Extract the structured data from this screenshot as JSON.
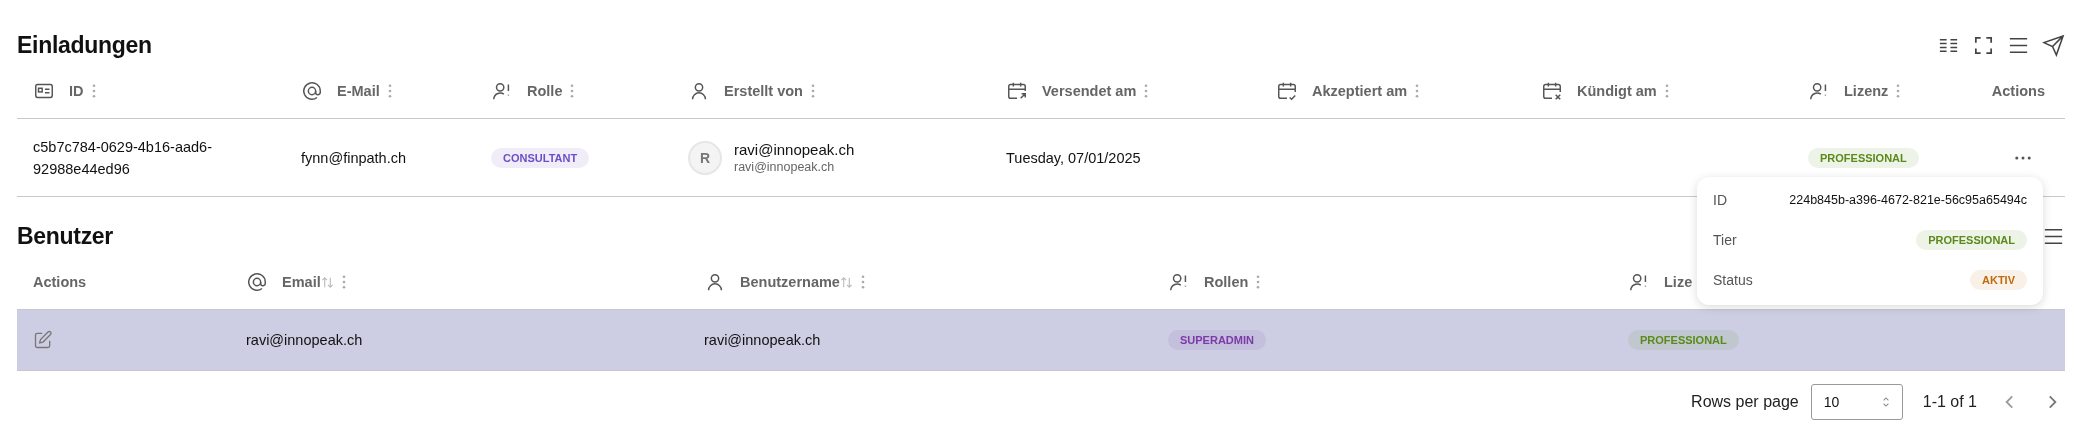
{
  "invitations": {
    "title": "Einladungen",
    "columns": [
      {
        "kind": "id",
        "label": "ID",
        "menu": true
      },
      {
        "kind": "email",
        "label": "E-Mail",
        "menu": true
      },
      {
        "kind": "role",
        "label": "Rolle",
        "menu": true
      },
      {
        "kind": "person",
        "label": "Erstellt von",
        "menu": true
      },
      {
        "kind": "sent",
        "label": "Versendet am",
        "menu": true
      },
      {
        "kind": "accepted",
        "label": "Akzeptiert am",
        "menu": true
      },
      {
        "kind": "terminated",
        "label": "Kündigt am",
        "menu": true
      },
      {
        "kind": "license",
        "label": "Lizenz",
        "menu": true
      },
      {
        "kind": "actions",
        "label": "Actions"
      }
    ],
    "rows": [
      {
        "selected": false,
        "cells": [
          {
            "kind": "text",
            "text": "c5b7c784-0629-4b16-aad6-92988e44ed96"
          },
          {
            "kind": "text",
            "text": "fynn@finpath.ch"
          },
          {
            "kind": "badge",
            "text": "CONSULTANT",
            "color": "#6a4fc8"
          },
          {
            "kind": "user",
            "avatar": "R",
            "name": "ravi@innopeak.ch",
            "email": "ravi@innopeak.ch"
          },
          {
            "kind": "text",
            "text": "Tuesday, 07/01/2025"
          },
          {
            "kind": "empty"
          },
          {
            "kind": "empty"
          },
          {
            "kind": "badge",
            "text": "PROFESSIONAL",
            "color": "#5a8a1a"
          },
          {
            "kind": "more"
          }
        ]
      }
    ]
  },
  "users": {
    "title": "Benutzer",
    "columns": [
      {
        "kind": "actions",
        "label": "Actions"
      },
      {
        "kind": "email",
        "label": "Email",
        "menu": true,
        "sortable": true
      },
      {
        "kind": "person",
        "label": "Benutzername",
        "menu": true,
        "sortable": true
      },
      {
        "kind": "role",
        "label": "Rollen",
        "menu": true
      },
      {
        "kind": "license",
        "label": "Lize"
      }
    ],
    "rows": [
      {
        "selected": true,
        "cells": [
          {
            "kind": "edit"
          },
          {
            "kind": "text",
            "text": "ravi@innopeak.ch"
          },
          {
            "kind": "text",
            "text": "ravi@innopeak.ch"
          },
          {
            "kind": "badge",
            "text": "SUPERADMIN",
            "color": "#7a3aa8"
          },
          {
            "kind": "badge",
            "text": "PROFESSIONAL",
            "color": "#5a8a1a"
          }
        ]
      }
    ],
    "pagination": {
      "rows_per_page_label": "Rows per page",
      "rows_per_page": "10",
      "range": "1-1 of 1"
    }
  },
  "popover": {
    "rows": [
      {
        "kind": "text",
        "label": "ID",
        "value": "224b845b-a396-4672-821e-56c95a65494c"
      },
      {
        "kind": "badge",
        "label": "Tier",
        "value": "PROFESSIONAL",
        "color": "#5a8a1a"
      },
      {
        "kind": "badge",
        "label": "Status",
        "value": "AKTIV",
        "color": "#c06a10"
      }
    ]
  }
}
